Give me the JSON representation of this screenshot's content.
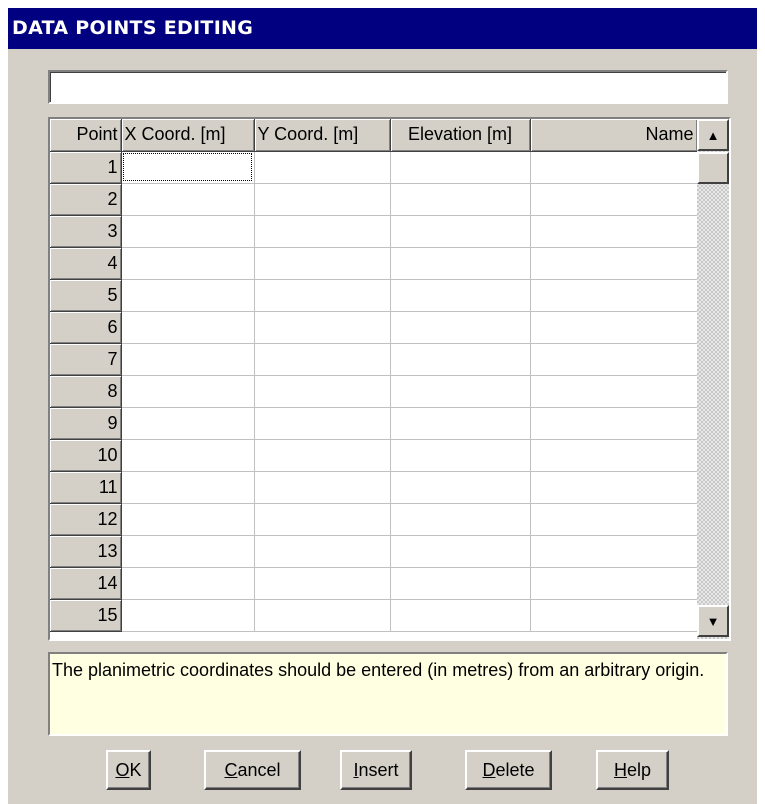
{
  "window": {
    "title": "DATA POINTS EDITING"
  },
  "top_field": {
    "value": ""
  },
  "grid": {
    "columns": [
      "Point",
      "X Coord. [m]",
      "Y Coord. [m]",
      "Elevation [m]",
      "Name"
    ],
    "rows": [
      {
        "point": "1",
        "x": "",
        "y": "",
        "elevation": "",
        "name": ""
      },
      {
        "point": "2",
        "x": "",
        "y": "",
        "elevation": "",
        "name": ""
      },
      {
        "point": "3",
        "x": "",
        "y": "",
        "elevation": "",
        "name": ""
      },
      {
        "point": "4",
        "x": "",
        "y": "",
        "elevation": "",
        "name": ""
      },
      {
        "point": "5",
        "x": "",
        "y": "",
        "elevation": "",
        "name": ""
      },
      {
        "point": "6",
        "x": "",
        "y": "",
        "elevation": "",
        "name": ""
      },
      {
        "point": "7",
        "x": "",
        "y": "",
        "elevation": "",
        "name": ""
      },
      {
        "point": "8",
        "x": "",
        "y": "",
        "elevation": "",
        "name": ""
      },
      {
        "point": "9",
        "x": "",
        "y": "",
        "elevation": "",
        "name": ""
      },
      {
        "point": "10",
        "x": "",
        "y": "",
        "elevation": "",
        "name": ""
      },
      {
        "point": "11",
        "x": "",
        "y": "",
        "elevation": "",
        "name": ""
      },
      {
        "point": "12",
        "x": "",
        "y": "",
        "elevation": "",
        "name": ""
      },
      {
        "point": "13",
        "x": "",
        "y": "",
        "elevation": "",
        "name": ""
      },
      {
        "point": "14",
        "x": "",
        "y": "",
        "elevation": "",
        "name": ""
      },
      {
        "point": "15",
        "x": "",
        "y": "",
        "elevation": "",
        "name": ""
      }
    ]
  },
  "scrollbar": {
    "up_icon": "arrow-up-icon",
    "down_icon": "arrow-down-icon"
  },
  "message": "The planimetric coordinates should be entered (in metres) from an arbitrary origin.",
  "buttons": {
    "ok": {
      "mnemonic": "O",
      "rest": "K"
    },
    "cancel": {
      "mnemonic": "C",
      "rest": "ancel"
    },
    "insert": {
      "mnemonic": "I",
      "rest": "nsert"
    },
    "delete": {
      "mnemonic": "D",
      "rest": "elete"
    },
    "help": {
      "mnemonic": "H",
      "rest": "elp"
    }
  },
  "colors": {
    "title_bar": "#000080",
    "dialog_face": "#d4d0c8",
    "message_bg": "#ffffe1"
  }
}
